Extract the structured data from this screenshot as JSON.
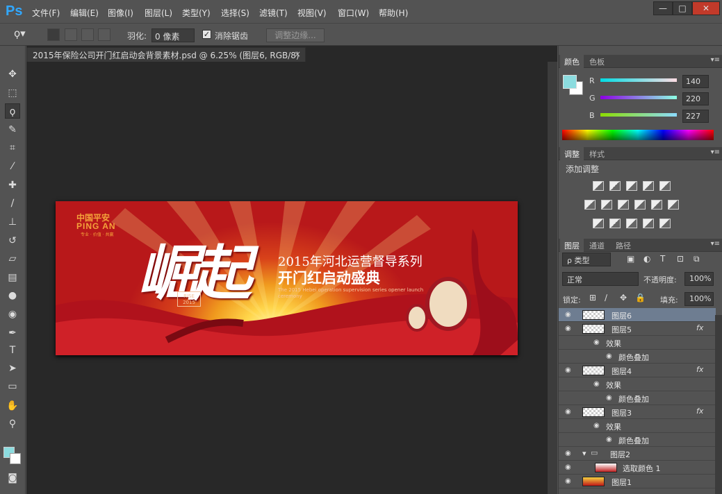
{
  "app": {
    "logo": "Ps"
  },
  "menu": [
    "文件(F)",
    "编辑(E)",
    "图像(I)",
    "图层(L)",
    "类型(Y)",
    "选择(S)",
    "滤镜(T)",
    "视图(V)",
    "窗口(W)",
    "帮助(H)"
  ],
  "window_controls": {
    "minimize": "—",
    "restore": "□",
    "close": "✕"
  },
  "options": {
    "feather_label": "羽化:",
    "feather_value": "0 像素",
    "antialias_label": "消除锯齿",
    "antialias_checked": true,
    "refine_label": "调整边缘..."
  },
  "document": {
    "tab_title": "2015年保险公司开门红启动会背景素材.psd @ 6.25% (图层6, RGB/8)",
    "close": "×"
  },
  "banner": {
    "logo_cn": "中国平安",
    "logo_en": "PING AN",
    "logo_tag": "专业 · 价值 · 共赢",
    "headline": "崛起",
    "stamp_line1": "RISE",
    "stamp_line2": "2015",
    "subtitle1": "2015年河北运营督导系列",
    "subtitle2": "开门红启动盛典",
    "subtitle3": "The 2015 Hebei operation supervision series opener launch ceremony"
  },
  "color_panel": {
    "tabs": [
      "颜色",
      "色板"
    ],
    "fg_color": "#8cdcdf",
    "r_label": "R",
    "g_label": "G",
    "b_label": "B",
    "r": "140",
    "g": "220",
    "b": "227"
  },
  "adjust_panel": {
    "tabs": [
      "调整",
      "样式"
    ],
    "title": "添加调整"
  },
  "layers_panel": {
    "tabs": [
      "图层",
      "通道",
      "路径"
    ],
    "filter_kind": "ρ 类型",
    "blend_mode": "正常",
    "opacity_label": "不透明度:",
    "opacity": "100%",
    "lock_label": "锁定:",
    "fill_label": "填充:",
    "fill": "100%",
    "layers": [
      {
        "name": "图层6",
        "fx": "",
        "selected": true
      },
      {
        "name": "图层5",
        "fx": "fx",
        "selected": false
      },
      {
        "name": "效果",
        "fx": "",
        "selected": false
      },
      {
        "name": "颜色叠加",
        "fx": "",
        "selected": false
      },
      {
        "name": "图层4",
        "fx": "fx",
        "selected": false
      },
      {
        "name": "效果",
        "fx": "",
        "selected": false
      },
      {
        "name": "颜色叠加",
        "fx": "",
        "selected": false
      },
      {
        "name": "图层3",
        "fx": "fx",
        "selected": false
      },
      {
        "name": "效果",
        "fx": "",
        "selected": false
      },
      {
        "name": "颜色叠加",
        "fx": "",
        "selected": false
      },
      {
        "name": "图层2",
        "fx": "",
        "selected": false
      },
      {
        "name": "选取颜色 1",
        "fx": "",
        "selected": false
      },
      {
        "name": "图层1",
        "fx": "",
        "selected": false
      }
    ]
  }
}
